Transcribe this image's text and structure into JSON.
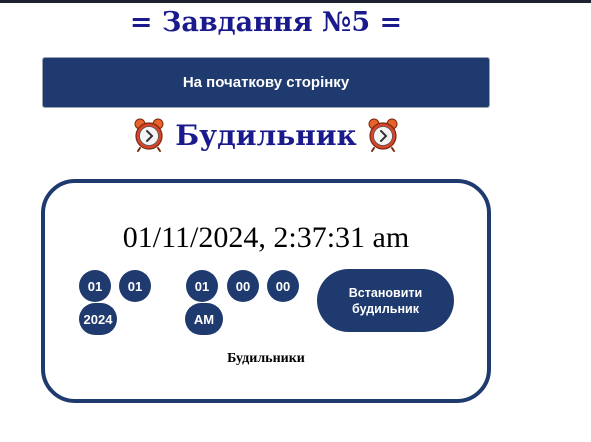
{
  "task_title": "= Завдання №5 =",
  "home_button_label": "На початкову сторінку",
  "alarm_heading": {
    "title": "Будильник",
    "left_icon": "alarm-clock-icon",
    "right_icon": "alarm-clock-icon"
  },
  "clock": {
    "current_time": "01/11/2024, 2:37:31 am"
  },
  "date_fields": {
    "day": "01",
    "month": "01",
    "year": "2024"
  },
  "time_fields": {
    "hour": "01",
    "minute": "00",
    "second": "00",
    "period": "AM"
  },
  "set_alarm_button_label": "Встановити будильник",
  "alarms_label": "Будильники",
  "colors": {
    "accent": "#1f3a6e",
    "heading": "#1a1a8c",
    "top_bar": "#1e2230"
  }
}
